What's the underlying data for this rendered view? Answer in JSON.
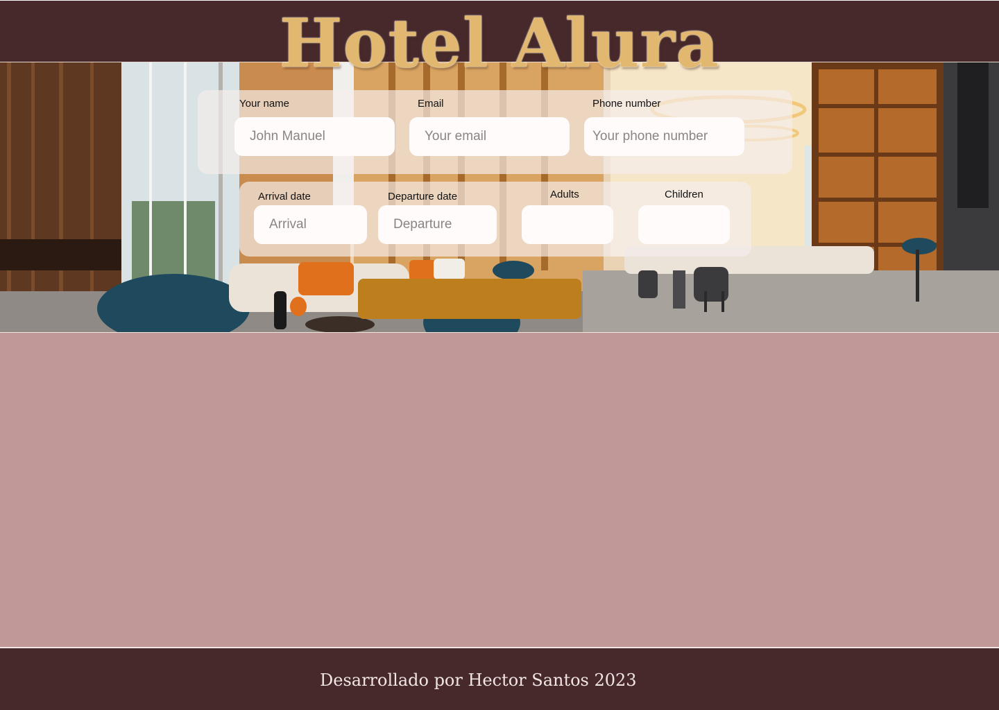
{
  "header": {
    "title": "Hotel Alura"
  },
  "form": {
    "name": {
      "label": "Your name",
      "placeholder": "John Manuel"
    },
    "email": {
      "label": "Email",
      "placeholder": "Your email"
    },
    "phone": {
      "label": "Phone number",
      "placeholder": "Your phone number"
    },
    "arrival": {
      "label": "Arrival date",
      "placeholder": "Arrival"
    },
    "departure": {
      "label": "Departure date",
      "placeholder": "Departure"
    },
    "adults": {
      "label": "Adults",
      "value": ""
    },
    "children": {
      "label": "Children",
      "value": ""
    },
    "submit_label": ""
  },
  "footer": {
    "text": "Desarrollado por Hector Santos 2023"
  },
  "colors": {
    "header_bg": "#47292c",
    "title": "#e2b76f",
    "page_bg": "#c19898",
    "button": "#bd7f1e",
    "footer_text": "#f1e6e2"
  }
}
